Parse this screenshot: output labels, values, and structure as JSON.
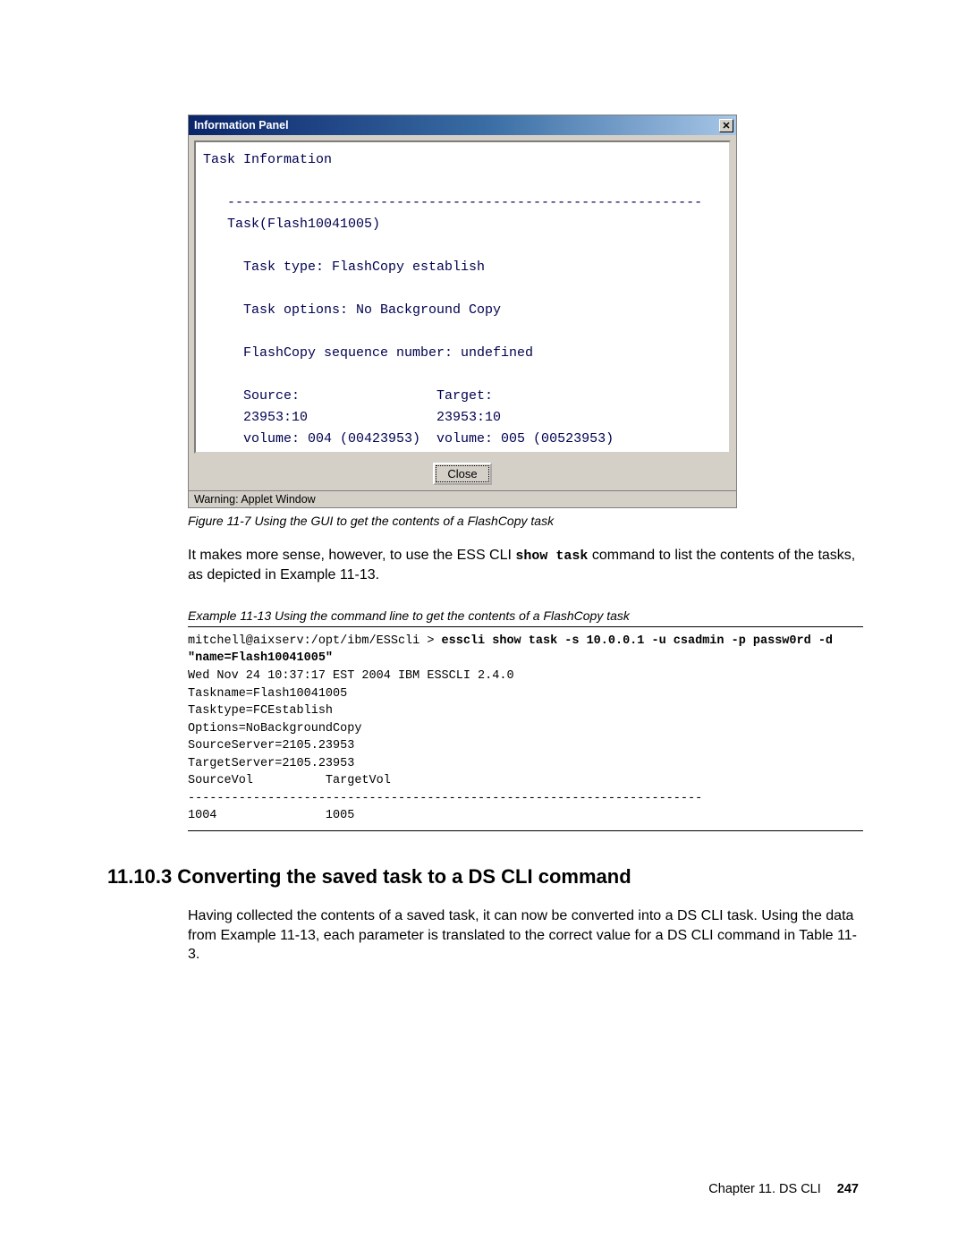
{
  "panel": {
    "title": "Information Panel",
    "close_glyph": "✕",
    "content": "Task Information\n\n   -----------------------------------------------------------\n   Task(Flash10041005)\n\n     Task type: FlashCopy establish\n\n     Task options: No Background Copy\n\n     FlashCopy sequence number: undefined\n\n     Source:                 Target:\n     23953:10                23953:10\n     volume: 004 (00423953)  volume: 005 (00523953)",
    "close_button": "Close",
    "statusbar": "Warning: Applet Window"
  },
  "figure_caption": "Figure 11-7   Using the GUI to get the contents of a FlashCopy task",
  "para1_a": "It makes more sense, however, to use the ESS CLI ",
  "para1_cmd": "show task",
  "para1_b": " command to list the contents of the tasks, as depicted in Example 11-13.",
  "example_caption": "Example 11-13   Using the command line to get the contents of a FlashCopy task",
  "example": {
    "prompt": "mitchell@aixserv:/opt/ibm/ESScli > ",
    "cmd": "esscli show task -s 10.0.0.1 -u csadmin -p passw0rd -d \"name=Flash10041005\"",
    "output": "Wed Nov 24 10:37:17 EST 2004 IBM ESSCLI 2.4.0\nTaskname=Flash10041005\nTasktype=FCEstablish\nOptions=NoBackgroundCopy\nSourceServer=2105.23953\nTargetServer=2105.23953\nSourceVol          TargetVol\n-----------------------------------------------------------------------\n1004               1005"
  },
  "section_heading": "11.10.3  Converting the saved task to a DS CLI command",
  "para2": "Having collected the contents of a saved task, it can now be converted into a DS CLI task. Using the data from Example 11-13, each parameter is translated to the correct value for a DS CLI command in Table 11-3.",
  "footer_chapter": "Chapter 11. DS CLI",
  "footer_page": "247"
}
